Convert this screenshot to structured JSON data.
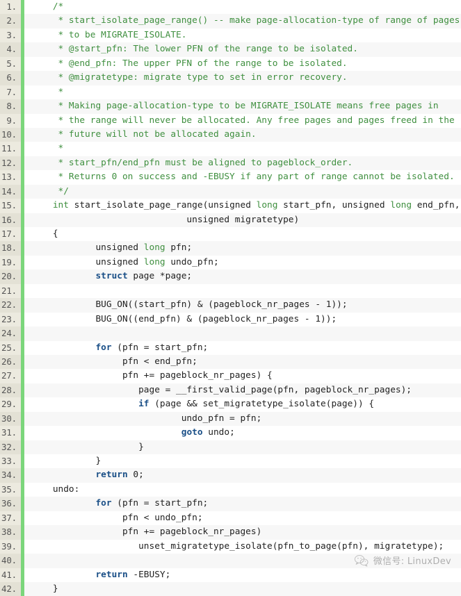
{
  "viewer": {
    "type": "code-listing",
    "language": "C",
    "gutter_suffix": ".",
    "colors": {
      "comment": "#3f8f3f",
      "keyword": "#1a4f87",
      "type": "#3f8f3f",
      "plain": "#222222",
      "marker_bar": "#7bd67b",
      "gutter_bg": "#e8e6dc",
      "row_odd_bg": "#ffffff",
      "row_even_bg": "#f7f7f7"
    }
  },
  "lines": [
    {
      "n": "1.",
      "segments": [
        {
          "t": "comment",
          "s": "    /*"
        }
      ]
    },
    {
      "n": "2.",
      "segments": [
        {
          "t": "comment",
          "s": "     * start_isolate_page_range() -- make page-allocation-type of range of pages"
        }
      ]
    },
    {
      "n": "3.",
      "segments": [
        {
          "t": "comment",
          "s": "     * to be MIGRATE_ISOLATE."
        }
      ]
    },
    {
      "n": "4.",
      "segments": [
        {
          "t": "comment",
          "s": "     * @start_pfn: The lower PFN of the range to be isolated."
        }
      ]
    },
    {
      "n": "5.",
      "segments": [
        {
          "t": "comment",
          "s": "     * @end_pfn: The upper PFN of the range to be isolated."
        }
      ]
    },
    {
      "n": "6.",
      "segments": [
        {
          "t": "comment",
          "s": "     * @migratetype: migrate type to set in error recovery."
        }
      ]
    },
    {
      "n": "7.",
      "segments": [
        {
          "t": "comment",
          "s": "     *"
        }
      ]
    },
    {
      "n": "8.",
      "segments": [
        {
          "t": "comment",
          "s": "     * Making page-allocation-type to be MIGRATE_ISOLATE means free pages in"
        }
      ]
    },
    {
      "n": "9.",
      "segments": [
        {
          "t": "comment",
          "s": "     * the range will never be allocated. Any free pages and pages freed in the"
        }
      ]
    },
    {
      "n": "10.",
      "segments": [
        {
          "t": "comment",
          "s": "     * future will not be allocated again."
        }
      ]
    },
    {
      "n": "11.",
      "segments": [
        {
          "t": "comment",
          "s": "     *"
        }
      ]
    },
    {
      "n": "12.",
      "segments": [
        {
          "t": "comment",
          "s": "     * start_pfn/end_pfn must be aligned to pageblock_order."
        }
      ]
    },
    {
      "n": "13.",
      "segments": [
        {
          "t": "comment",
          "s": "     * Returns 0 on success and -EBUSY if any part of range cannot be isolated."
        }
      ]
    },
    {
      "n": "14.",
      "segments": [
        {
          "t": "comment",
          "s": "     */"
        }
      ]
    },
    {
      "n": "15.",
      "segments": [
        {
          "t": "plain",
          "s": "    "
        },
        {
          "t": "type",
          "s": "int"
        },
        {
          "t": "plain",
          "s": " start_isolate_page_range(unsigned "
        },
        {
          "t": "type",
          "s": "long"
        },
        {
          "t": "plain",
          "s": " start_pfn, unsigned "
        },
        {
          "t": "type",
          "s": "long"
        },
        {
          "t": "plain",
          "s": " end_pfn,"
        }
      ]
    },
    {
      "n": "16.",
      "segments": [
        {
          "t": "plain",
          "s": "                             unsigned migratetype)"
        }
      ]
    },
    {
      "n": "17.",
      "segments": [
        {
          "t": "plain",
          "s": "    {"
        }
      ]
    },
    {
      "n": "18.",
      "segments": [
        {
          "t": "plain",
          "s": "            unsigned "
        },
        {
          "t": "type",
          "s": "long"
        },
        {
          "t": "plain",
          "s": " pfn;"
        }
      ]
    },
    {
      "n": "19.",
      "segments": [
        {
          "t": "plain",
          "s": "            unsigned "
        },
        {
          "t": "type",
          "s": "long"
        },
        {
          "t": "plain",
          "s": " undo_pfn;"
        }
      ]
    },
    {
      "n": "20.",
      "segments": [
        {
          "t": "plain",
          "s": "            "
        },
        {
          "t": "kw",
          "s": "struct"
        },
        {
          "t": "plain",
          "s": " page *page;"
        }
      ]
    },
    {
      "n": "21.",
      "segments": [
        {
          "t": "plain",
          "s": ""
        }
      ]
    },
    {
      "n": "22.",
      "segments": [
        {
          "t": "plain",
          "s": "            BUG_ON((start_pfn) & (pageblock_nr_pages - 1));"
        }
      ]
    },
    {
      "n": "23.",
      "segments": [
        {
          "t": "plain",
          "s": "            BUG_ON((end_pfn) & (pageblock_nr_pages - 1));"
        }
      ]
    },
    {
      "n": "24.",
      "segments": [
        {
          "t": "plain",
          "s": ""
        }
      ]
    },
    {
      "n": "25.",
      "segments": [
        {
          "t": "plain",
          "s": "            "
        },
        {
          "t": "kw",
          "s": "for"
        },
        {
          "t": "plain",
          "s": " (pfn = start_pfn;"
        }
      ]
    },
    {
      "n": "26.",
      "segments": [
        {
          "t": "plain",
          "s": "                 pfn < end_pfn;"
        }
      ]
    },
    {
      "n": "27.",
      "segments": [
        {
          "t": "plain",
          "s": "                 pfn += pageblock_nr_pages) {"
        }
      ]
    },
    {
      "n": "28.",
      "segments": [
        {
          "t": "plain",
          "s": "                    page = __first_valid_page(pfn, pageblock_nr_pages);"
        }
      ]
    },
    {
      "n": "29.",
      "segments": [
        {
          "t": "plain",
          "s": "                    "
        },
        {
          "t": "kw",
          "s": "if"
        },
        {
          "t": "plain",
          "s": " (page && set_migratetype_isolate(page)) {"
        }
      ]
    },
    {
      "n": "30.",
      "segments": [
        {
          "t": "plain",
          "s": "                            undo_pfn = pfn;"
        }
      ]
    },
    {
      "n": "31.",
      "segments": [
        {
          "t": "plain",
          "s": "                            "
        },
        {
          "t": "kw",
          "s": "goto"
        },
        {
          "t": "plain",
          "s": " undo;"
        }
      ]
    },
    {
      "n": "32.",
      "segments": [
        {
          "t": "plain",
          "s": "                    }"
        }
      ]
    },
    {
      "n": "33.",
      "segments": [
        {
          "t": "plain",
          "s": "            }"
        }
      ]
    },
    {
      "n": "34.",
      "segments": [
        {
          "t": "plain",
          "s": "            "
        },
        {
          "t": "kw",
          "s": "return"
        },
        {
          "t": "plain",
          "s": " 0;"
        }
      ]
    },
    {
      "n": "35.",
      "segments": [
        {
          "t": "plain",
          "s": "    undo:"
        }
      ]
    },
    {
      "n": "36.",
      "segments": [
        {
          "t": "plain",
          "s": "            "
        },
        {
          "t": "kw",
          "s": "for"
        },
        {
          "t": "plain",
          "s": " (pfn = start_pfn;"
        }
      ]
    },
    {
      "n": "37.",
      "segments": [
        {
          "t": "plain",
          "s": "                 pfn < undo_pfn;"
        }
      ]
    },
    {
      "n": "38.",
      "segments": [
        {
          "t": "plain",
          "s": "                 pfn += pageblock_nr_pages)"
        }
      ]
    },
    {
      "n": "39.",
      "segments": [
        {
          "t": "plain",
          "s": "                    unset_migratetype_isolate(pfn_to_page(pfn), migratetype);"
        }
      ]
    },
    {
      "n": "40.",
      "segments": [
        {
          "t": "plain",
          "s": ""
        }
      ]
    },
    {
      "n": "41.",
      "segments": [
        {
          "t": "plain",
          "s": "            "
        },
        {
          "t": "kw",
          "s": "return"
        },
        {
          "t": "plain",
          "s": " -EBUSY;"
        }
      ]
    },
    {
      "n": "42.",
      "segments": [
        {
          "t": "plain",
          "s": "    }"
        }
      ]
    }
  ],
  "watermark": {
    "icon": "wechat-icon",
    "text": "微信号: LinuxDev"
  }
}
